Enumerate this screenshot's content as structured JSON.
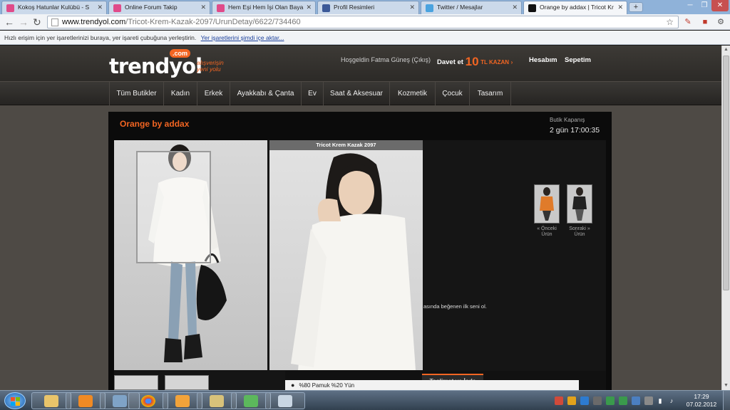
{
  "browser": {
    "tabs": [
      {
        "label": "Kokoş Hatunlar Kulübü - S",
        "favicon_color": "#e04b8a"
      },
      {
        "label": "Online Forum Takip",
        "favicon_color": "#e04b8a"
      },
      {
        "label": "Hem Eşi Hem İşi Olan Baya",
        "favicon_color": "#e04b8a"
      },
      {
        "label": "Profil Resimleri",
        "favicon_color": "#3b5998"
      },
      {
        "label": "Twitter / Mesajlar",
        "favicon_color": "#4aa3df"
      },
      {
        "label": "Orange by addax | Tricot Kr",
        "favicon_color": "#111111"
      }
    ],
    "new_tab_label": "+",
    "url": {
      "host": "www.trendyol.com",
      "path": "/Tricot-Krem-Kazak-2097/UrunDetay/6622/734460"
    },
    "bookmark_bar": {
      "text": "Hızlı erişim için yer işaretlerinizi buraya, yer işareti çubuğuna yerleştirin.",
      "link": "Yer işaretlerini şimdi içe aktar..."
    }
  },
  "site": {
    "logo_text": "trendyol",
    "logo_com": ".com",
    "slogan_line1": "alışverişin",
    "slogan_line2": "yeni yolu",
    "greeting": "Hoşgeldin Fatma Güneş (Çıkış)",
    "invite": {
      "prefix": "Davet et",
      "amount": "10",
      "suffix": "TL KAZAN",
      "arrow": "›"
    },
    "account_link": "Hesabım",
    "cart_link": "Sepetim",
    "nav": [
      "Tüm Butikler",
      "Kadın",
      "Erkek",
      "Ayakkabı & Çanta",
      "Ev",
      "Saat & Aksesuar",
      "Kozmetik",
      "Çocuk",
      "Tasarım"
    ]
  },
  "product": {
    "boutique_title": "Orange by addax",
    "closing_label": "Butik Kapanış",
    "closing_time": "2 gün 17:00:35",
    "zoom_caption": "Tricot Krem Kazak 2097",
    "info_fragment": "asında beğenen ilk seni ol.",
    "prev_label": "« Önceki Ürün",
    "next_label": "Sonraki » Ürün",
    "delivery_tab": "Teslimat ve İade",
    "material_bullet": "●",
    "material": "%80 Pamuk %20 Yün"
  },
  "taskbar": {
    "clock_time": "17:29",
    "clock_date": "07.02.2012"
  },
  "colors": {
    "brand_orange": "#f26522",
    "header_bg": "#3d3a36",
    "panel_bg": "#0b0b0b"
  }
}
